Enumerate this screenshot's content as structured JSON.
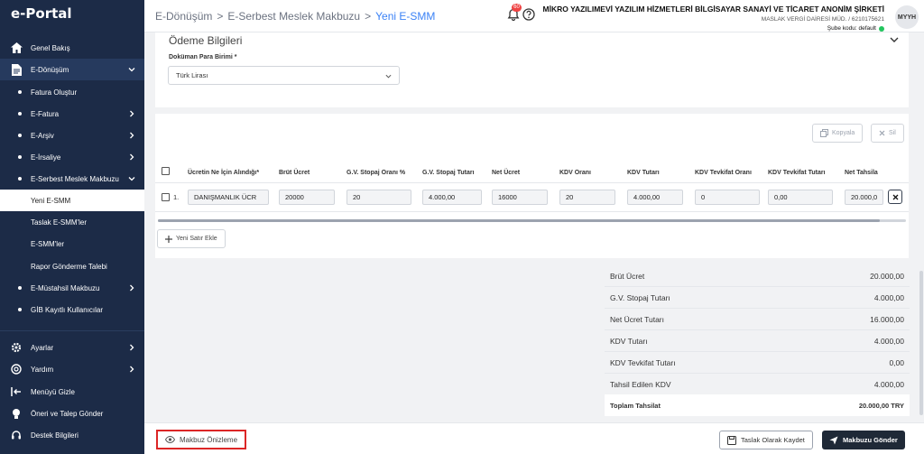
{
  "app": {
    "logo": "e-Portal"
  },
  "sidebar": {
    "items": [
      {
        "label": "Genel Bakış"
      },
      {
        "label": "E-Dönüşüm"
      },
      {
        "label": "Fatura Oluştur"
      },
      {
        "label": "E-Fatura"
      },
      {
        "label": "E-Arşiv"
      },
      {
        "label": "E-İrsaliye"
      },
      {
        "label": "E-Serbest Meslek Makbuzu"
      },
      {
        "label": "Yeni E-SMM"
      },
      {
        "label": "Taslak E-SMM'ler"
      },
      {
        "label": "E-SMM'ler"
      },
      {
        "label": "Rapor Gönderme Talebi"
      },
      {
        "label": "E-Müstahsil Makbuzu"
      },
      {
        "label": "GİB Kayıtlı Kullanıcılar"
      }
    ],
    "bottom": [
      {
        "label": "Ayarlar"
      },
      {
        "label": "Yardım"
      },
      {
        "label": "Menüyü Gizle"
      },
      {
        "label": "Öneri ve Talep Gönder"
      },
      {
        "label": "Destek Bilgileri"
      }
    ]
  },
  "header": {
    "breadcrumb": [
      "E-Dönüşüm",
      ">",
      "E-Serbest Meslek Makbuzu",
      ">",
      "Yeni E-SMM"
    ],
    "notif_count": "60",
    "company_name": "MİKRO YAZILIMEVİ YAZILIM HİZMETLERİ BİLGİSAYAR SANAYİ VE TİCARET ANONİM ŞİRKETİ",
    "tax_office": "MASLAK VERGİ DAİRESİ MÜD. / 6210175621",
    "branch": "Şube kodu: default",
    "avatar": "MYYH"
  },
  "payment": {
    "title": "Ödeme Bilgileri",
    "currency_label": "Doküman Para Birimi *",
    "currency_value": "Türk Lirası"
  },
  "toolbar": {
    "copy": "Kopyala",
    "delete": "Sil",
    "add_row": "Yeni Satır Ekle"
  },
  "table": {
    "headers": [
      "Ücretin Ne İçin Alındığı*",
      "Brüt Ücret",
      "G.V. Stopaj Oranı %",
      "G.V. Stopaj Tutarı",
      "Net Ücret",
      "KDV Oranı",
      "KDV Tutarı",
      "KDV Tevkifat Oranı",
      "KDV Tevkifat Tutarı",
      "Net Tahsila"
    ],
    "row": {
      "num": "1.",
      "cells": [
        "DANIŞMANLIK ÜCR",
        "20000",
        "20",
        "4.000,00",
        "16000",
        "20",
        "4.000,00",
        "0",
        "0,00",
        "20.000,0"
      ]
    }
  },
  "summary": [
    {
      "label": "Brüt Ücret",
      "value": "20.000,00"
    },
    {
      "label": "G.V. Stopaj Tutarı",
      "value": "4.000,00"
    },
    {
      "label": "Net Ücret Tutarı",
      "value": "16.000,00"
    },
    {
      "label": "KDV Tutarı",
      "value": "4.000,00"
    },
    {
      "label": "KDV Tevkifat Tutarı",
      "value": "0,00"
    },
    {
      "label": "Tahsil Edilen KDV",
      "value": "4.000,00"
    },
    {
      "label": "Toplam Tahsilat",
      "value": "20.000,00 TRY"
    }
  ],
  "footer": {
    "preview": "Makbuz Önizleme",
    "draft": "Taslak Olarak Kaydet",
    "send": "Makbuzu Gönder"
  },
  "colors": {
    "sidebar": "#1c2b47",
    "accent": "#3b82f6",
    "highlight": "#dc2626",
    "primary_button": "#1f2937"
  }
}
